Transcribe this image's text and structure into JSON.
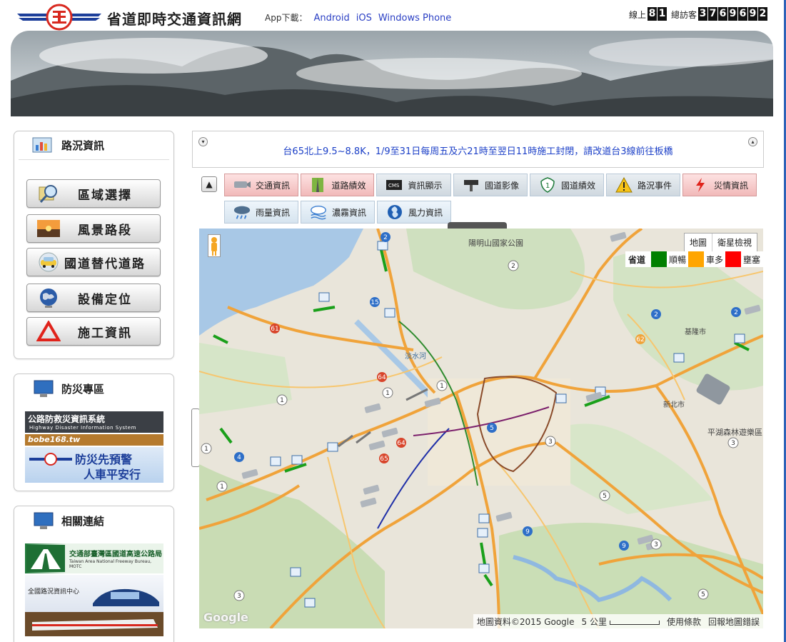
{
  "header": {
    "site_title": "省道即時交通資訊網",
    "app_download_label": "App下載：",
    "app_links": [
      "Android",
      "iOS",
      "Windows Phone"
    ],
    "online_label": "線上",
    "online_count": [
      "8",
      "1"
    ],
    "visitors_label": "總訪客",
    "visitor_count": [
      "3",
      "7",
      "6",
      "9",
      "6",
      "9",
      "2"
    ]
  },
  "sidebar": {
    "road_info": {
      "title": "路況資訊",
      "items": [
        {
          "label": "區域選擇",
          "icon": "magnifier-map-icon"
        },
        {
          "label": "風景路段",
          "icon": "landscape-icon"
        },
        {
          "label": "國道替代道路",
          "icon": "taxi-car-icon"
        },
        {
          "label": "設備定位",
          "icon": "globe-icon"
        },
        {
          "label": "施工資訊",
          "icon": "warning-triangle-icon"
        }
      ]
    },
    "disaster": {
      "title": "防災專區",
      "banner1_title": "公路防救災資訊系統",
      "banner1_sub": "Highway Disaster Information System",
      "banner2_url": "bobe168.tw",
      "banner3_line1": "防災先預警",
      "banner3_line2": "人車平安行"
    },
    "links": {
      "title": "相關連結",
      "banner1_title": "交通部臺灣區國道高速公路局",
      "banner1_sub": "Taiwan Area National Freeway Bureau, MOTC",
      "banner2_title": "全國路況資訊中心"
    }
  },
  "notice": {
    "text": "台65北上9.5~8.8K，1/9至31日每周五及六21時至翌日11時施工封閉，請改道台3線前往板橋"
  },
  "tabs": {
    "row1": [
      {
        "label": "交通資訊",
        "icon": "camera-icon",
        "style": "red"
      },
      {
        "label": "道路績效",
        "icon": "road-icon",
        "style": "red"
      },
      {
        "label": "資訊顯示",
        "icon": "cms-sign-icon",
        "style": "dark"
      },
      {
        "label": "國道影像",
        "icon": "freeway-camera-icon",
        "style": "dark"
      },
      {
        "label": "國道績效",
        "icon": "freeway-shield-icon",
        "style": "dark"
      },
      {
        "label": "路況事件",
        "icon": "warning-icon",
        "style": "dark"
      },
      {
        "label": "災情資訊",
        "icon": "lightning-icon",
        "style": "red"
      }
    ],
    "row2": [
      {
        "label": "雨量資訊",
        "icon": "rain-cloud-icon"
      },
      {
        "label": "濃霧資訊",
        "icon": "fog-icon"
      },
      {
        "label": "風力資訊",
        "icon": "wind-icon"
      }
    ]
  },
  "map": {
    "type_buttons": [
      "地圖",
      "衛星檢視"
    ],
    "legend_title": "省道",
    "legend": [
      {
        "label": "順暢",
        "color": "#008000"
      },
      {
        "label": "車多",
        "color": "#ffa500"
      },
      {
        "label": "壅塞",
        "color": "#ff0000"
      }
    ],
    "places": [
      "陽明山國家公園",
      "淡水河",
      "基隆市",
      "新北市",
      "平湖森林遊樂區"
    ],
    "footer": {
      "copyright": "地圖資料©2015 Google",
      "scale": "5 公里",
      "terms": "使用條款",
      "report": "回報地圖錯誤"
    },
    "google_logo": "Google"
  }
}
